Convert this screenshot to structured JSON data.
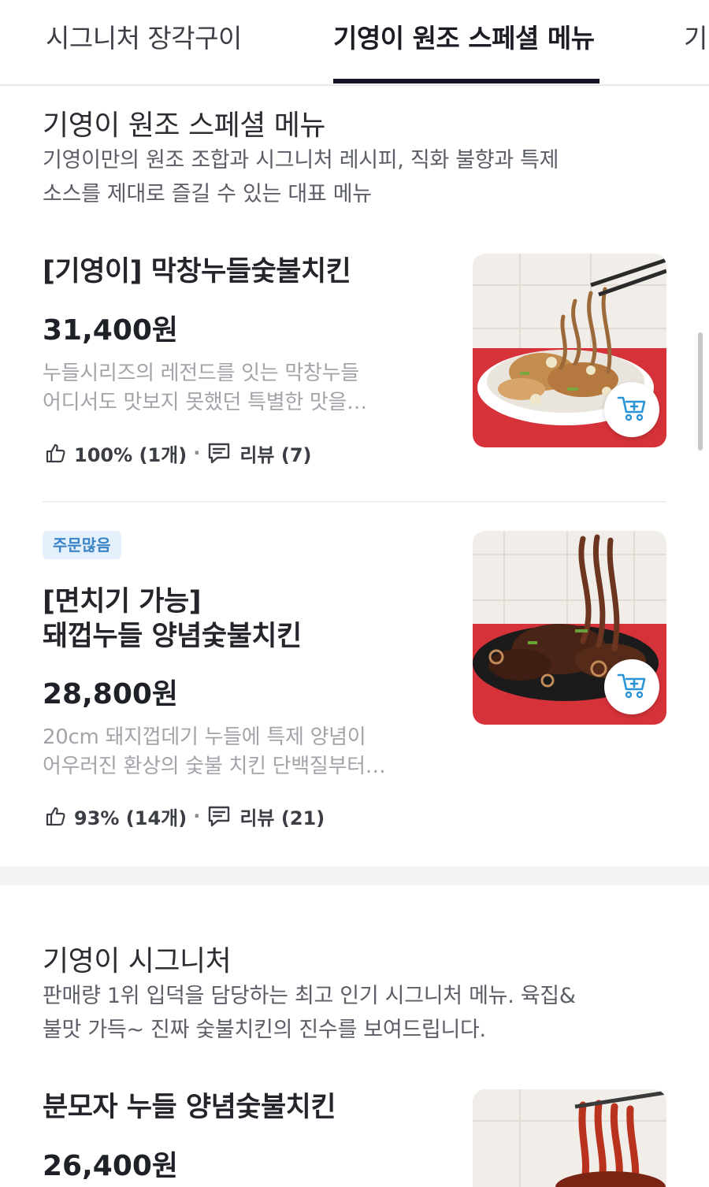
{
  "tabs": [
    {
      "label": "시그니처 장각구이",
      "selected": false
    },
    {
      "label": "기영이 원조 스페셜 메뉴",
      "selected": true
    },
    {
      "label": "기",
      "selected": false
    }
  ],
  "sections": [
    {
      "title": "기영이 원조 스페셜 메뉴",
      "description_lines": [
        "기영이만의 원조 조합과 시그니처 레시피, 직화 불향과 특제",
        "소스를 제대로 즐길 수 있는 대표 메뉴"
      ],
      "items": [
        {
          "name_lines": [
            "[기영이] 막창누들숯불치킨"
          ],
          "price": "31,400원",
          "description_lines": [
            "누들시리즈의 레전드를 잇는 막창누들",
            "어디서도 맛보지 못했던 특별한 맛을…"
          ],
          "like": "100% (1개)",
          "review": "리뷰 (7)",
          "image_icon": "grilled-chicken-noodle-photo"
        },
        {
          "badge": "주문많음",
          "name_lines": [
            "[면치기 가능]",
            "돼껍누들 양념숯불치킨"
          ],
          "price": "28,800원",
          "description_lines": [
            "20cm 돼지껍데기 누들에 특제 양념이",
            "어우러진 환상의 숯불 치킨 단백질부터…"
          ],
          "like": "93% (14개)",
          "review": "리뷰 (21)",
          "image_icon": "sauced-chicken-noodle-photo"
        }
      ]
    },
    {
      "title": "기영이 시그니처",
      "description_lines": [
        "판매량 1위 입덕을 담당하는 최고 인기 시그니처 메뉴. 육집&",
        "불맛 가득~ 진짜 숯불치킨의 진수를 보여드립니다."
      ],
      "items": [
        {
          "name_lines": [
            "분모자 누들 양념숯불치킨"
          ],
          "price": "26,400원",
          "image_icon": "bunmoja-noodle-chicken-photo"
        }
      ]
    }
  ],
  "icons": {
    "like": "thumbs-up-icon",
    "review": "speech-bubble-icon",
    "cart": "cart-add-icon"
  },
  "colors": {
    "tab_indicator": "#171427",
    "badge_bg": "#e4f0fb",
    "badge_text": "#3a84c8",
    "cart_icon": "#2a93d5"
  }
}
